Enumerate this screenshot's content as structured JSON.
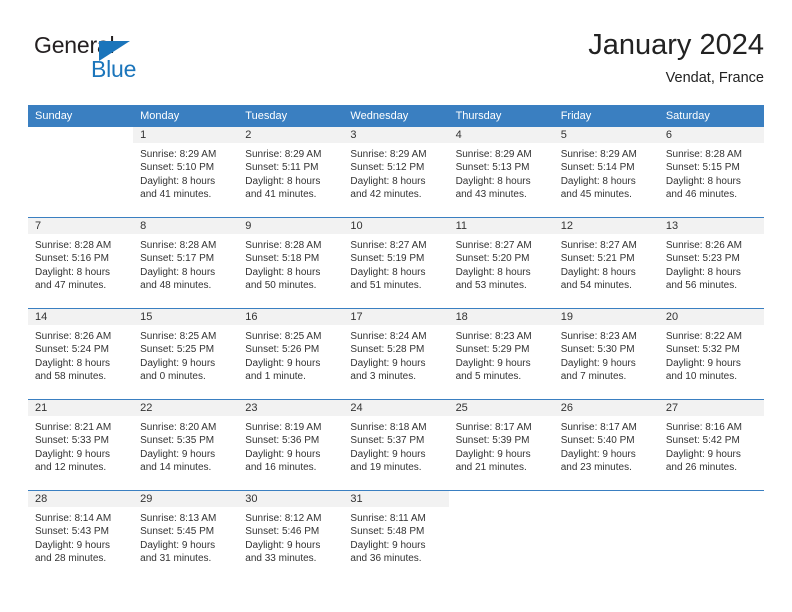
{
  "logo": {
    "primary_text": "General",
    "secondary_text": "Blue",
    "triangle_icon": "blue-triangle-icon",
    "primary_color": "#231f20",
    "secondary_color": "#1b75bb"
  },
  "header": {
    "title": "January 2024",
    "subtitle": "Vendat, France"
  },
  "colors": {
    "header_blue": "#3a7fc1",
    "daynum_band": "#f2f2f2",
    "text": "#333333"
  },
  "calendar": {
    "day_headers": [
      "Sunday",
      "Monday",
      "Tuesday",
      "Wednesday",
      "Thursday",
      "Friday",
      "Saturday"
    ],
    "weeks": [
      [
        {
          "day": "",
          "lines": []
        },
        {
          "day": "1",
          "lines": [
            "Sunrise: 8:29 AM",
            "Sunset: 5:10 PM",
            "Daylight: 8 hours",
            "and 41 minutes."
          ]
        },
        {
          "day": "2",
          "lines": [
            "Sunrise: 8:29 AM",
            "Sunset: 5:11 PM",
            "Daylight: 8 hours",
            "and 41 minutes."
          ]
        },
        {
          "day": "3",
          "lines": [
            "Sunrise: 8:29 AM",
            "Sunset: 5:12 PM",
            "Daylight: 8 hours",
            "and 42 minutes."
          ]
        },
        {
          "day": "4",
          "lines": [
            "Sunrise: 8:29 AM",
            "Sunset: 5:13 PM",
            "Daylight: 8 hours",
            "and 43 minutes."
          ]
        },
        {
          "day": "5",
          "lines": [
            "Sunrise: 8:29 AM",
            "Sunset: 5:14 PM",
            "Daylight: 8 hours",
            "and 45 minutes."
          ]
        },
        {
          "day": "6",
          "lines": [
            "Sunrise: 8:28 AM",
            "Sunset: 5:15 PM",
            "Daylight: 8 hours",
            "and 46 minutes."
          ]
        }
      ],
      [
        {
          "day": "7",
          "lines": [
            "Sunrise: 8:28 AM",
            "Sunset: 5:16 PM",
            "Daylight: 8 hours",
            "and 47 minutes."
          ]
        },
        {
          "day": "8",
          "lines": [
            "Sunrise: 8:28 AM",
            "Sunset: 5:17 PM",
            "Daylight: 8 hours",
            "and 48 minutes."
          ]
        },
        {
          "day": "9",
          "lines": [
            "Sunrise: 8:28 AM",
            "Sunset: 5:18 PM",
            "Daylight: 8 hours",
            "and 50 minutes."
          ]
        },
        {
          "day": "10",
          "lines": [
            "Sunrise: 8:27 AM",
            "Sunset: 5:19 PM",
            "Daylight: 8 hours",
            "and 51 minutes."
          ]
        },
        {
          "day": "11",
          "lines": [
            "Sunrise: 8:27 AM",
            "Sunset: 5:20 PM",
            "Daylight: 8 hours",
            "and 53 minutes."
          ]
        },
        {
          "day": "12",
          "lines": [
            "Sunrise: 8:27 AM",
            "Sunset: 5:21 PM",
            "Daylight: 8 hours",
            "and 54 minutes."
          ]
        },
        {
          "day": "13",
          "lines": [
            "Sunrise: 8:26 AM",
            "Sunset: 5:23 PM",
            "Daylight: 8 hours",
            "and 56 minutes."
          ]
        }
      ],
      [
        {
          "day": "14",
          "lines": [
            "Sunrise: 8:26 AM",
            "Sunset: 5:24 PM",
            "Daylight: 8 hours",
            "and 58 minutes."
          ]
        },
        {
          "day": "15",
          "lines": [
            "Sunrise: 8:25 AM",
            "Sunset: 5:25 PM",
            "Daylight: 9 hours",
            "and 0 minutes."
          ]
        },
        {
          "day": "16",
          "lines": [
            "Sunrise: 8:25 AM",
            "Sunset: 5:26 PM",
            "Daylight: 9 hours",
            "and 1 minute."
          ]
        },
        {
          "day": "17",
          "lines": [
            "Sunrise: 8:24 AM",
            "Sunset: 5:28 PM",
            "Daylight: 9 hours",
            "and 3 minutes."
          ]
        },
        {
          "day": "18",
          "lines": [
            "Sunrise: 8:23 AM",
            "Sunset: 5:29 PM",
            "Daylight: 9 hours",
            "and 5 minutes."
          ]
        },
        {
          "day": "19",
          "lines": [
            "Sunrise: 8:23 AM",
            "Sunset: 5:30 PM",
            "Daylight: 9 hours",
            "and 7 minutes."
          ]
        },
        {
          "day": "20",
          "lines": [
            "Sunrise: 8:22 AM",
            "Sunset: 5:32 PM",
            "Daylight: 9 hours",
            "and 10 minutes."
          ]
        }
      ],
      [
        {
          "day": "21",
          "lines": [
            "Sunrise: 8:21 AM",
            "Sunset: 5:33 PM",
            "Daylight: 9 hours",
            "and 12 minutes."
          ]
        },
        {
          "day": "22",
          "lines": [
            "Sunrise: 8:20 AM",
            "Sunset: 5:35 PM",
            "Daylight: 9 hours",
            "and 14 minutes."
          ]
        },
        {
          "day": "23",
          "lines": [
            "Sunrise: 8:19 AM",
            "Sunset: 5:36 PM",
            "Daylight: 9 hours",
            "and 16 minutes."
          ]
        },
        {
          "day": "24",
          "lines": [
            "Sunrise: 8:18 AM",
            "Sunset: 5:37 PM",
            "Daylight: 9 hours",
            "and 19 minutes."
          ]
        },
        {
          "day": "25",
          "lines": [
            "Sunrise: 8:17 AM",
            "Sunset: 5:39 PM",
            "Daylight: 9 hours",
            "and 21 minutes."
          ]
        },
        {
          "day": "26",
          "lines": [
            "Sunrise: 8:17 AM",
            "Sunset: 5:40 PM",
            "Daylight: 9 hours",
            "and 23 minutes."
          ]
        },
        {
          "day": "27",
          "lines": [
            "Sunrise: 8:16 AM",
            "Sunset: 5:42 PM",
            "Daylight: 9 hours",
            "and 26 minutes."
          ]
        }
      ],
      [
        {
          "day": "28",
          "lines": [
            "Sunrise: 8:14 AM",
            "Sunset: 5:43 PM",
            "Daylight: 9 hours",
            "and 28 minutes."
          ]
        },
        {
          "day": "29",
          "lines": [
            "Sunrise: 8:13 AM",
            "Sunset: 5:45 PM",
            "Daylight: 9 hours",
            "and 31 minutes."
          ]
        },
        {
          "day": "30",
          "lines": [
            "Sunrise: 8:12 AM",
            "Sunset: 5:46 PM",
            "Daylight: 9 hours",
            "and 33 minutes."
          ]
        },
        {
          "day": "31",
          "lines": [
            "Sunrise: 8:11 AM",
            "Sunset: 5:48 PM",
            "Daylight: 9 hours",
            "and 36 minutes."
          ]
        },
        {
          "day": "",
          "lines": []
        },
        {
          "day": "",
          "lines": []
        },
        {
          "day": "",
          "lines": []
        }
      ]
    ]
  }
}
